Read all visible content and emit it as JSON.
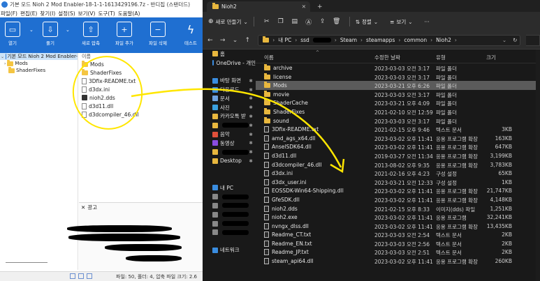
{
  "bandizip": {
    "title": "기본 모드 Nioh 2 Mod Enabler-18-1-1-1613429196.7z - 반디집 (스탠더드)",
    "menu": [
      "파일(F)",
      "편집(E)",
      "찾기(I)",
      "설정(S)",
      "보기(V)",
      "도구(T)",
      "도움말(A)"
    ],
    "toolbar": [
      {
        "label": "열기",
        "icon": "folder-open-icon"
      },
      {
        "label": "풀기",
        "icon": "extract-icon"
      },
      {
        "label": "새로 압축",
        "icon": "new-archive-icon"
      },
      {
        "label": "파일 추가",
        "icon": "add-file-icon"
      },
      {
        "label": "파일 삭제",
        "icon": "delete-file-icon"
      },
      {
        "label": "테스트",
        "icon": "test-icon"
      }
    ],
    "tree": {
      "root": "기본 모드 Nioh 2 Mod Enabler-",
      "children": [
        "Mods",
        "ShaderFixes"
      ]
    },
    "list_header": "이름",
    "files": [
      {
        "name": "Mods",
        "kind": "folder"
      },
      {
        "name": "ShaderFixes",
        "kind": "folder"
      },
      {
        "name": "3Dfix-README.txt",
        "kind": "doc"
      },
      {
        "name": "d3dx.ini",
        "kind": "doc"
      },
      {
        "name": "nioh2.dds",
        "kind": "dds"
      },
      {
        "name": "d3d11.dll",
        "kind": "doc"
      },
      {
        "name": "d3dcompiler_46.dll",
        "kind": "doc"
      }
    ],
    "ad_label": "광고",
    "status": "파일: 50, 폴더: 4, 압축 파일 크기: 2.6"
  },
  "explorer": {
    "tab_title": "Nioh2",
    "toolbar": {
      "new_label": "새로 만들기",
      "sort_label": "정렬",
      "view_label": "보기",
      "more_label": "···"
    },
    "address": [
      "내 PC",
      "ssd",
      "Steam",
      "steamapps",
      "common",
      "Nioh2"
    ],
    "columns": {
      "name": "이름",
      "date": "수정한 날짜",
      "type": "유형",
      "size": "크기"
    },
    "nav": [
      {
        "label": "홈",
        "icon": "home-icon",
        "color": "#e8b73e"
      },
      {
        "label": "OneDrive - 개인",
        "icon": "cloud-icon",
        "color": "#3a8de0"
      },
      {
        "label": "",
        "icon": "",
        "color": ""
      },
      {
        "label": "바탕 화면",
        "icon": "desktop-icon",
        "color": "#3a8de0"
      },
      {
        "label": "다운로드",
        "icon": "download-icon",
        "color": "#3a8de0"
      },
      {
        "label": "문서",
        "icon": "documents-icon",
        "color": "#6fa3e0"
      },
      {
        "label": "사진",
        "icon": "pictures-icon",
        "color": "#3aa0e0"
      },
      {
        "label": "카카오톡 받",
        "icon": "folder-icon",
        "color": "#e8b73e"
      },
      {
        "label": "",
        "icon": "folder-icon",
        "color": "#e8b73e"
      },
      {
        "label": "음악",
        "icon": "music-icon",
        "color": "#e0503a"
      },
      {
        "label": "동영상",
        "icon": "video-icon",
        "color": "#8a4ce0"
      },
      {
        "label": "",
        "icon": "folder-icon",
        "color": "#e8b73e"
      },
      {
        "label": "Desktop",
        "icon": "folder-icon",
        "color": "#e8b73e"
      },
      {
        "label": "",
        "icon": "",
        "color": ""
      },
      {
        "label": "",
        "icon": "",
        "color": ""
      },
      {
        "label": "내 PC",
        "icon": "pc-icon",
        "color": "#3a8de0"
      },
      {
        "label": "",
        "icon": "drive-icon",
        "color": "#888888"
      },
      {
        "label": "",
        "icon": "drive-icon",
        "color": "#888888"
      },
      {
        "label": "",
        "icon": "drive-icon",
        "color": "#888888"
      },
      {
        "label": "",
        "icon": "drive-icon",
        "color": "#888888"
      },
      {
        "label": "",
        "icon": "drive-icon",
        "color": "#888888"
      },
      {
        "label": "",
        "icon": "",
        "color": ""
      },
      {
        "label": "네트워크",
        "icon": "network-icon",
        "color": "#3a8de0"
      }
    ],
    "files": [
      {
        "name": "archive",
        "date": "2023-03-03 오전 3:17",
        "type": "파일 폴더",
        "size": "",
        "kind": "folder"
      },
      {
        "name": "license",
        "date": "2023-03-03 오전 3:17",
        "type": "파일 폴더",
        "size": "",
        "kind": "folder"
      },
      {
        "name": "Mods",
        "date": "2023-03-21 오후 6:26",
        "type": "파일 폴더",
        "size": "",
        "kind": "folder",
        "selected": true
      },
      {
        "name": "movie",
        "date": "2023-03-03 오전 3:17",
        "type": "파일 폴더",
        "size": "",
        "kind": "folder"
      },
      {
        "name": "ShaderCache",
        "date": "2023-03-21 오후 4:09",
        "type": "파일 폴더",
        "size": "",
        "kind": "folder"
      },
      {
        "name": "ShaderFixes",
        "date": "2021-02-10 오전 12:59",
        "type": "파일 폴더",
        "size": "",
        "kind": "folder"
      },
      {
        "name": "sound",
        "date": "2023-03-03 오전 3:17",
        "type": "파일 폴더",
        "size": "",
        "kind": "folder"
      },
      {
        "name": "3Dfix-README.txt",
        "date": "2021-02-15 오후 9:46",
        "type": "텍스트 문서",
        "size": "3KB",
        "kind": "doc"
      },
      {
        "name": "amd_ags_x64.dll",
        "date": "2023-03-02 오후 11:41",
        "type": "응용 프로그램 확장",
        "size": "163KB",
        "kind": "doc"
      },
      {
        "name": "AnselSDK64.dll",
        "date": "2023-03-02 오후 11:41",
        "type": "응용 프로그램 확장",
        "size": "647KB",
        "kind": "doc"
      },
      {
        "name": "d3d11.dll",
        "date": "2019-03-27 오전 11:34",
        "type": "응용 프로그램 확장",
        "size": "3,199KB",
        "kind": "doc"
      },
      {
        "name": "d3dcompiler_46.dll",
        "date": "2013-08-02 오후 9:35",
        "type": "응용 프로그램 확장",
        "size": "3,783KB",
        "kind": "doc"
      },
      {
        "name": "d3dx.ini",
        "date": "2021-02-16 오후 4:23",
        "type": "구성 설정",
        "size": "65KB",
        "kind": "doc"
      },
      {
        "name": "d3dx_user.ini",
        "date": "2023-03-21 오전 12:33",
        "type": "구성 설정",
        "size": "1KB",
        "kind": "doc"
      },
      {
        "name": "EOSSDK-Win64-Shipping.dll",
        "date": "2023-03-02 오후 11:41",
        "type": "응용 프로그램 확장",
        "size": "21,747KB",
        "kind": "doc"
      },
      {
        "name": "GfeSDK.dll",
        "date": "2023-03-02 오후 11:41",
        "type": "응용 프로그램 확장",
        "size": "4,148KB",
        "kind": "doc"
      },
      {
        "name": "nioh2.dds",
        "date": "2021-02-15 오후 8:33",
        "type": "이미지(dds) 파일",
        "size": "1,251KB",
        "kind": "doc"
      },
      {
        "name": "nioh2.exe",
        "date": "2023-03-02 오후 11:41",
        "type": "응용 프로그램",
        "size": "32,241KB",
        "kind": "exe"
      },
      {
        "name": "nvngx_dlss.dll",
        "date": "2023-03-02 오후 11:41",
        "type": "응용 프로그램 확장",
        "size": "13,435KB",
        "kind": "doc"
      },
      {
        "name": "Readme_CT.txt",
        "date": "2023-03-03 오전 2:54",
        "type": "텍스트 문서",
        "size": "2KB",
        "kind": "doc"
      },
      {
        "name": "Readme_EN.txt",
        "date": "2023-03-03 오전 2:56",
        "type": "텍스트 문서",
        "size": "2KB",
        "kind": "doc"
      },
      {
        "name": "Readme_JP.txt",
        "date": "2023-03-03 오전 2:51",
        "type": "텍스트 문서",
        "size": "2KB",
        "kind": "doc"
      },
      {
        "name": "steam_api64.dll",
        "date": "2023-03-02 오후 11:41",
        "type": "응용 프로그램 확장",
        "size": "260KB",
        "kind": "doc"
      }
    ]
  },
  "colors": {
    "bandizip_blue": "#1f6fd1",
    "annotation_yellow": "#ffe600",
    "explorer_bg": "#191919",
    "folder_yellow": "#e8b73e",
    "selection": "#5b5b5b"
  }
}
